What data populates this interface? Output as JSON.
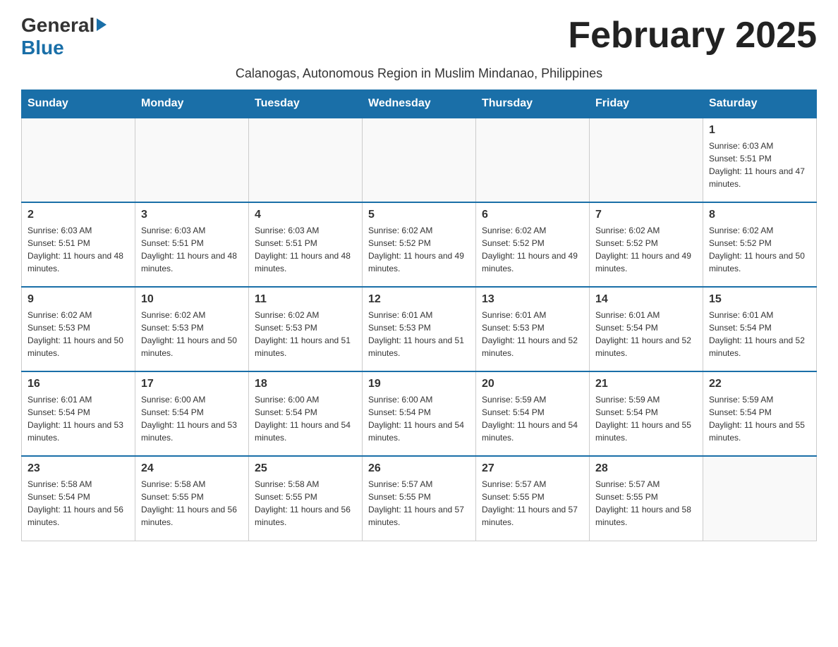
{
  "header": {
    "logo_general": "General",
    "logo_blue": "Blue",
    "month_title": "February 2025",
    "subtitle": "Calanogas, Autonomous Region in Muslim Mindanao, Philippines"
  },
  "weekdays": [
    "Sunday",
    "Monday",
    "Tuesday",
    "Wednesday",
    "Thursday",
    "Friday",
    "Saturday"
  ],
  "weeks": [
    [
      {
        "day": "",
        "info": ""
      },
      {
        "day": "",
        "info": ""
      },
      {
        "day": "",
        "info": ""
      },
      {
        "day": "",
        "info": ""
      },
      {
        "day": "",
        "info": ""
      },
      {
        "day": "",
        "info": ""
      },
      {
        "day": "1",
        "info": "Sunrise: 6:03 AM\nSunset: 5:51 PM\nDaylight: 11 hours and 47 minutes."
      }
    ],
    [
      {
        "day": "2",
        "info": "Sunrise: 6:03 AM\nSunset: 5:51 PM\nDaylight: 11 hours and 48 minutes."
      },
      {
        "day": "3",
        "info": "Sunrise: 6:03 AM\nSunset: 5:51 PM\nDaylight: 11 hours and 48 minutes."
      },
      {
        "day": "4",
        "info": "Sunrise: 6:03 AM\nSunset: 5:51 PM\nDaylight: 11 hours and 48 minutes."
      },
      {
        "day": "5",
        "info": "Sunrise: 6:02 AM\nSunset: 5:52 PM\nDaylight: 11 hours and 49 minutes."
      },
      {
        "day": "6",
        "info": "Sunrise: 6:02 AM\nSunset: 5:52 PM\nDaylight: 11 hours and 49 minutes."
      },
      {
        "day": "7",
        "info": "Sunrise: 6:02 AM\nSunset: 5:52 PM\nDaylight: 11 hours and 49 minutes."
      },
      {
        "day": "8",
        "info": "Sunrise: 6:02 AM\nSunset: 5:52 PM\nDaylight: 11 hours and 50 minutes."
      }
    ],
    [
      {
        "day": "9",
        "info": "Sunrise: 6:02 AM\nSunset: 5:53 PM\nDaylight: 11 hours and 50 minutes."
      },
      {
        "day": "10",
        "info": "Sunrise: 6:02 AM\nSunset: 5:53 PM\nDaylight: 11 hours and 50 minutes."
      },
      {
        "day": "11",
        "info": "Sunrise: 6:02 AM\nSunset: 5:53 PM\nDaylight: 11 hours and 51 minutes."
      },
      {
        "day": "12",
        "info": "Sunrise: 6:01 AM\nSunset: 5:53 PM\nDaylight: 11 hours and 51 minutes."
      },
      {
        "day": "13",
        "info": "Sunrise: 6:01 AM\nSunset: 5:53 PM\nDaylight: 11 hours and 52 minutes."
      },
      {
        "day": "14",
        "info": "Sunrise: 6:01 AM\nSunset: 5:54 PM\nDaylight: 11 hours and 52 minutes."
      },
      {
        "day": "15",
        "info": "Sunrise: 6:01 AM\nSunset: 5:54 PM\nDaylight: 11 hours and 52 minutes."
      }
    ],
    [
      {
        "day": "16",
        "info": "Sunrise: 6:01 AM\nSunset: 5:54 PM\nDaylight: 11 hours and 53 minutes."
      },
      {
        "day": "17",
        "info": "Sunrise: 6:00 AM\nSunset: 5:54 PM\nDaylight: 11 hours and 53 minutes."
      },
      {
        "day": "18",
        "info": "Sunrise: 6:00 AM\nSunset: 5:54 PM\nDaylight: 11 hours and 54 minutes."
      },
      {
        "day": "19",
        "info": "Sunrise: 6:00 AM\nSunset: 5:54 PM\nDaylight: 11 hours and 54 minutes."
      },
      {
        "day": "20",
        "info": "Sunrise: 5:59 AM\nSunset: 5:54 PM\nDaylight: 11 hours and 54 minutes."
      },
      {
        "day": "21",
        "info": "Sunrise: 5:59 AM\nSunset: 5:54 PM\nDaylight: 11 hours and 55 minutes."
      },
      {
        "day": "22",
        "info": "Sunrise: 5:59 AM\nSunset: 5:54 PM\nDaylight: 11 hours and 55 minutes."
      }
    ],
    [
      {
        "day": "23",
        "info": "Sunrise: 5:58 AM\nSunset: 5:54 PM\nDaylight: 11 hours and 56 minutes."
      },
      {
        "day": "24",
        "info": "Sunrise: 5:58 AM\nSunset: 5:55 PM\nDaylight: 11 hours and 56 minutes."
      },
      {
        "day": "25",
        "info": "Sunrise: 5:58 AM\nSunset: 5:55 PM\nDaylight: 11 hours and 56 minutes."
      },
      {
        "day": "26",
        "info": "Sunrise: 5:57 AM\nSunset: 5:55 PM\nDaylight: 11 hours and 57 minutes."
      },
      {
        "day": "27",
        "info": "Sunrise: 5:57 AM\nSunset: 5:55 PM\nDaylight: 11 hours and 57 minutes."
      },
      {
        "day": "28",
        "info": "Sunrise: 5:57 AM\nSunset: 5:55 PM\nDaylight: 11 hours and 58 minutes."
      },
      {
        "day": "",
        "info": ""
      }
    ]
  ]
}
